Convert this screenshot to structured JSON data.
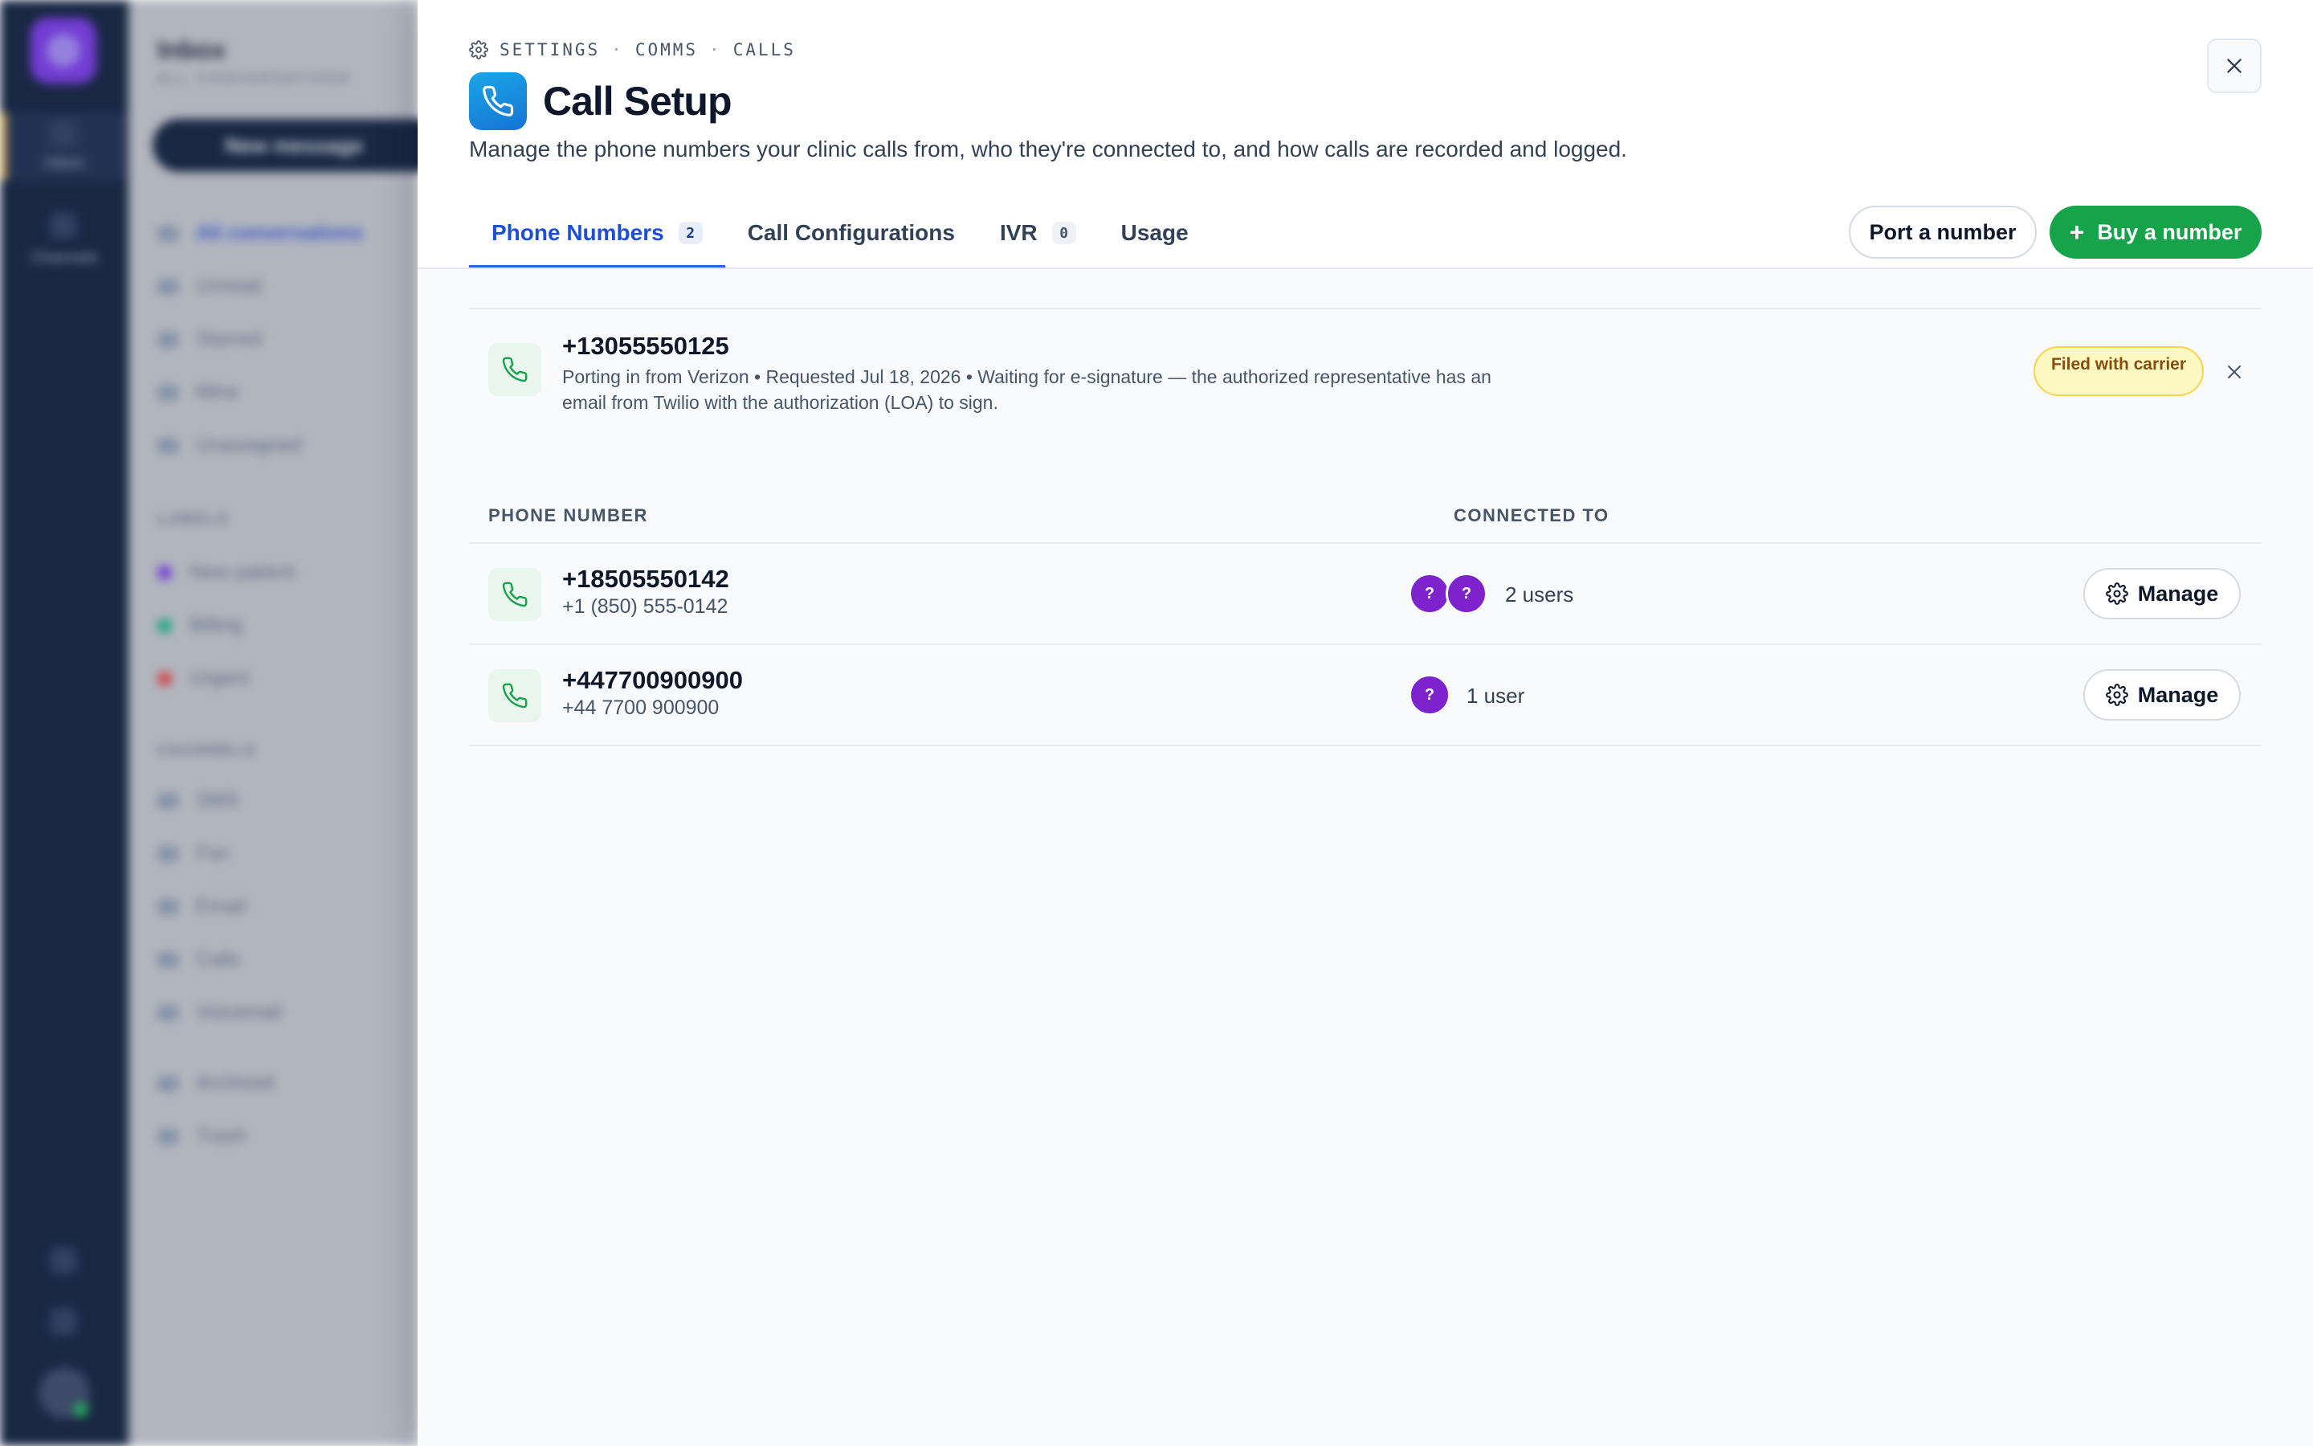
{
  "background_app": {
    "rail": {
      "home_label": "Inbox",
      "channels_label": "Channels"
    },
    "panel": {
      "title": "Inbox",
      "subtitle": "ALL CONVERSATIONS",
      "new_message": "New message",
      "views": [
        "All conversations",
        "Unread",
        "Starred",
        "Mine",
        "Unassigned"
      ],
      "labels_header": "LABELS",
      "labels": [
        {
          "name": "New patient",
          "color": "#7c3aed"
        },
        {
          "name": "Billing",
          "color": "#10b981"
        },
        {
          "name": "Urgent",
          "color": "#ef4444"
        }
      ],
      "channels_header": "CHANNELS",
      "channels": [
        "SMS",
        "Fax",
        "Email",
        "Calls",
        "Voicemail"
      ],
      "archive": [
        "Archived",
        "Trash"
      ]
    }
  },
  "modal": {
    "breadcrumb": {
      "parts": [
        "SETTINGS",
        "COMMS",
        "CALLS"
      ],
      "separator": "·"
    },
    "title": "Call Setup",
    "description": "Manage the phone numbers your clinic calls from, who they're connected to, and how calls are recorded and logged.",
    "tabs": [
      {
        "label": "Phone Numbers",
        "count": "2",
        "active": true
      },
      {
        "label": "Call Configurations",
        "count": null,
        "active": false
      },
      {
        "label": "IVR",
        "count": "0",
        "active": false
      },
      {
        "label": "Usage",
        "count": null,
        "active": false
      }
    ],
    "actions": {
      "port_label": "Port a number",
      "buy_label": "Buy a number",
      "buy_icon": "+"
    },
    "porting": {
      "number": "+13055550125",
      "detail": "Porting in from Verizon • Requested Jul 18, 2026 • Waiting for e-signature — the authorized representative has an email from Twilio with the authorization (LOA) to sign.",
      "status": "Filed with carrier"
    },
    "table": {
      "columns": [
        "PHONE NUMBER",
        "CONNECTED TO"
      ],
      "rows": [
        {
          "number": "+18505550142",
          "formatted": "+1 (850) 555-0142",
          "avatars": [
            "?",
            "?"
          ],
          "connected": "2 users",
          "action": "Manage"
        },
        {
          "number": "+447700900900",
          "formatted": "+44 7700 900900",
          "avatars": [
            "?"
          ],
          "connected": "1 user",
          "action": "Manage"
        }
      ]
    }
  },
  "colors": {
    "accent": "#2563eb",
    "primary_button": "#16a34a",
    "avatar": "#7e22ce",
    "badge_bg": "#fef9c3",
    "badge_text": "#854d0e"
  }
}
